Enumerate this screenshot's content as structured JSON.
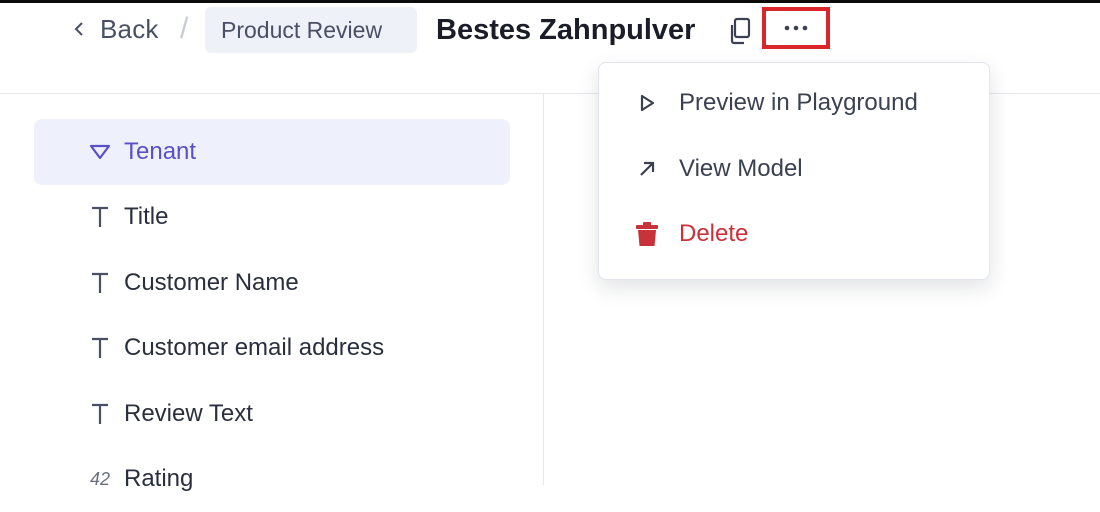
{
  "header": {
    "back_label": "Back",
    "breadcrumb": "Product Review",
    "title": "Bestes Zahnpulver"
  },
  "fields": [
    {
      "label": "Tenant",
      "icon": "filter-triangle-icon",
      "selected": true
    },
    {
      "label": "Title",
      "icon": "text-type-icon"
    },
    {
      "label": "Customer Name",
      "icon": "text-type-icon"
    },
    {
      "label": "Customer email address",
      "icon": "text-type-icon"
    },
    {
      "label": "Review Text",
      "icon": "text-type-icon"
    },
    {
      "label": "Rating",
      "icon": "number-type-icon",
      "icon_text": "42"
    }
  ],
  "menu": {
    "items": [
      {
        "label": "Preview in Playground",
        "icon": "play-icon"
      },
      {
        "label": "View Model",
        "icon": "arrow-up-right-icon"
      },
      {
        "label": "Delete",
        "icon": "trash-icon",
        "color": "#c8323a"
      }
    ]
  },
  "colors": {
    "accent": "#5a4fc9",
    "danger": "#c8323a",
    "highlight_box": "#d8262a"
  }
}
